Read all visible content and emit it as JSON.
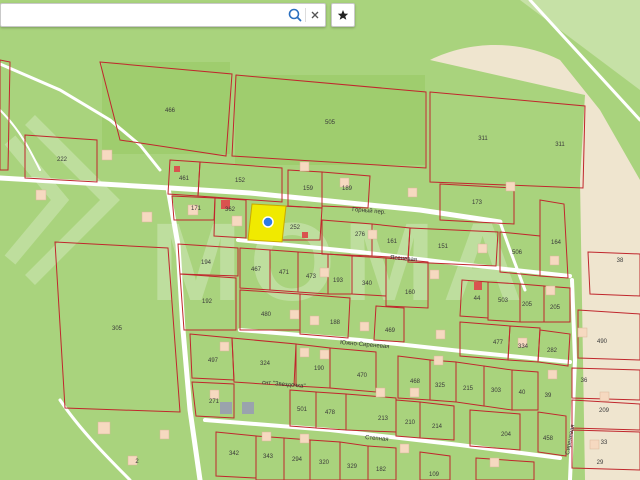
{
  "search": {
    "value": "",
    "placeholder": ""
  },
  "colors": {
    "background": "#a9d37d",
    "sand": "#efe5cf",
    "road": "#ffffff",
    "parcel_border": "#c0272d",
    "selected_parcel": "#f0ea00",
    "marker": "#2c7be5",
    "search_icon": "#2a6fbf"
  },
  "icons": {
    "search": "search-icon",
    "clear": "close-icon",
    "favorite": "star-icon",
    "marker": "location-marker-icon"
  },
  "map": {
    "parcels": [
      {
        "label": "466"
      },
      {
        "label": "505"
      },
      {
        "label": "311"
      },
      {
        "label": "311"
      },
      {
        "label": "222"
      },
      {
        "label": "461"
      },
      {
        "label": "152"
      },
      {
        "label": "159"
      },
      {
        "label": "189"
      },
      {
        "label": "171"
      },
      {
        "label": "362"
      },
      {
        "label": "252"
      },
      {
        "label": "173"
      },
      {
        "label": "276"
      },
      {
        "label": "161"
      },
      {
        "label": "151"
      },
      {
        "label": "164"
      },
      {
        "label": "506"
      },
      {
        "label": "38"
      },
      {
        "label": "194"
      },
      {
        "label": "467"
      },
      {
        "label": "471"
      },
      {
        "label": "473"
      },
      {
        "label": "193"
      },
      {
        "label": "340"
      },
      {
        "label": "160"
      },
      {
        "label": "44"
      },
      {
        "label": "503"
      },
      {
        "label": "205"
      },
      {
        "label": "205"
      },
      {
        "label": "192"
      },
      {
        "label": "305"
      },
      {
        "label": "480"
      },
      {
        "label": "188"
      },
      {
        "label": "469"
      },
      {
        "label": "477"
      },
      {
        "label": "334"
      },
      {
        "label": "282"
      },
      {
        "label": "490"
      },
      {
        "label": "497"
      },
      {
        "label": "324"
      },
      {
        "label": "190"
      },
      {
        "label": "470"
      },
      {
        "label": "468"
      },
      {
        "label": "325"
      },
      {
        "label": "215"
      },
      {
        "label": "303"
      },
      {
        "label": "40"
      },
      {
        "label": "36"
      },
      {
        "label": "271"
      },
      {
        "label": "501"
      },
      {
        "label": "478"
      },
      {
        "label": "213"
      },
      {
        "label": "210"
      },
      {
        "label": "214"
      },
      {
        "label": "204"
      },
      {
        "label": "39"
      },
      {
        "label": "209"
      },
      {
        "label": "458"
      },
      {
        "label": "33"
      },
      {
        "label": "342"
      },
      {
        "label": "343"
      },
      {
        "label": "294"
      },
      {
        "label": "320"
      },
      {
        "label": "329"
      },
      {
        "label": "182"
      },
      {
        "label": "109"
      },
      {
        "label": "29"
      },
      {
        "label": "2"
      }
    ],
    "streets": [
      {
        "name": "Горный пер."
      },
      {
        "name": "Ясеневая"
      },
      {
        "name": "Южно-Сиреневая"
      },
      {
        "name": "снт \"Звездочка\""
      },
      {
        "name": "Степная"
      },
      {
        "name": "Сиреневая"
      }
    ],
    "watermark": "MOMA"
  }
}
